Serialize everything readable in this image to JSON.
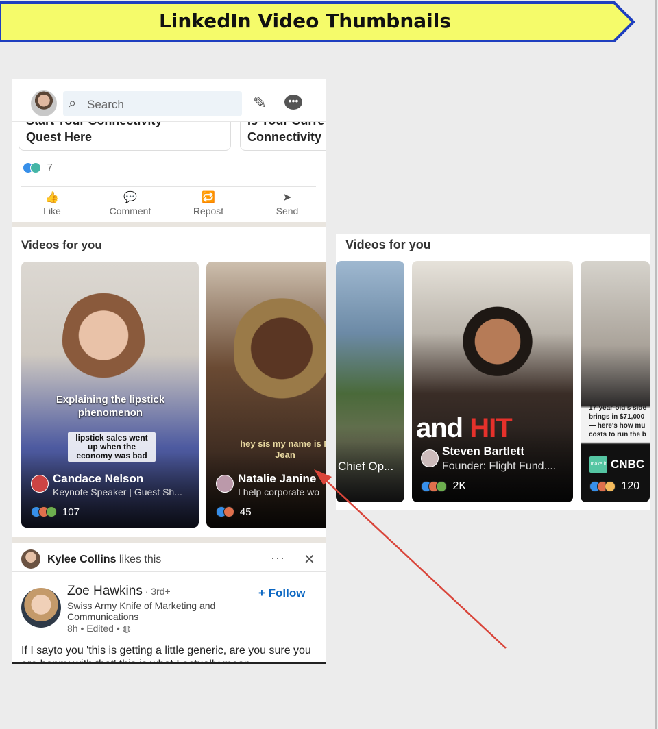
{
  "banner": {
    "title": "LinkedIn Video Thumbnails"
  },
  "topbar": {
    "search_placeholder": "Search"
  },
  "prev_post": {
    "card_a_line1": "Start Your Connectivity",
    "card_a_line2": "Quest Here",
    "card_b_line1": "Is Your Curre",
    "card_b_line2": "Connectivity",
    "reaction_count": "7",
    "actions": [
      {
        "label": "Like",
        "icon": "👍"
      },
      {
        "label": "Comment",
        "icon": "💬"
      },
      {
        "label": "Repost",
        "icon": "🔁"
      },
      {
        "label": "Send",
        "icon": "➤"
      }
    ]
  },
  "videos": {
    "section_title": "Videos for you",
    "cards": [
      {
        "caption": "Explaining the lipstick phenomenon",
        "subcaption": "lipstick sales went up when the economy was bad",
        "name": "Candace Nelson",
        "subtitle": "Keynote Speaker | Guest Sh...",
        "reactions": "107"
      },
      {
        "caption": "hey sis my name is N Jean",
        "name": "Natalie Janine",
        "subtitle": "I help corporate wo",
        "reactions": "45"
      }
    ]
  },
  "feed_post": {
    "liker": "Kylee Collins",
    "liker_suffix": " likes this",
    "more": "···",
    "close": "✕",
    "author": "Zoe Hawkins",
    "degree": " · 3rd+",
    "headline": "Swiss Army Knife of Marketing and Communications",
    "time": "8h • Edited •",
    "follow": "+ Follow",
    "text": "If I sayto you 'this is getting a little generic, are you sure you are happy with that' this is what I actually mean"
  },
  "panel": {
    "section_title": "Videos for you",
    "cards": [
      {
        "subtitle": "Chief Op..."
      },
      {
        "overlay_text": "and ",
        "overlay_highlight": "HIT",
        "name": "Steven Bartlett",
        "subtitle": "Founder: Flight Fund....",
        "reactions": "2K"
      },
      {
        "caption": "17-year-old's side brings in $71,000 — here's how mu costs to run the b",
        "logo_text": "make it",
        "name": "CNBC",
        "reactions": "120"
      }
    ]
  },
  "colors": {
    "banner_fill": "#f5fb6a",
    "banner_stroke": "#1f3fbf",
    "follow": "#0a66c2",
    "arrow": "#d9453a"
  }
}
